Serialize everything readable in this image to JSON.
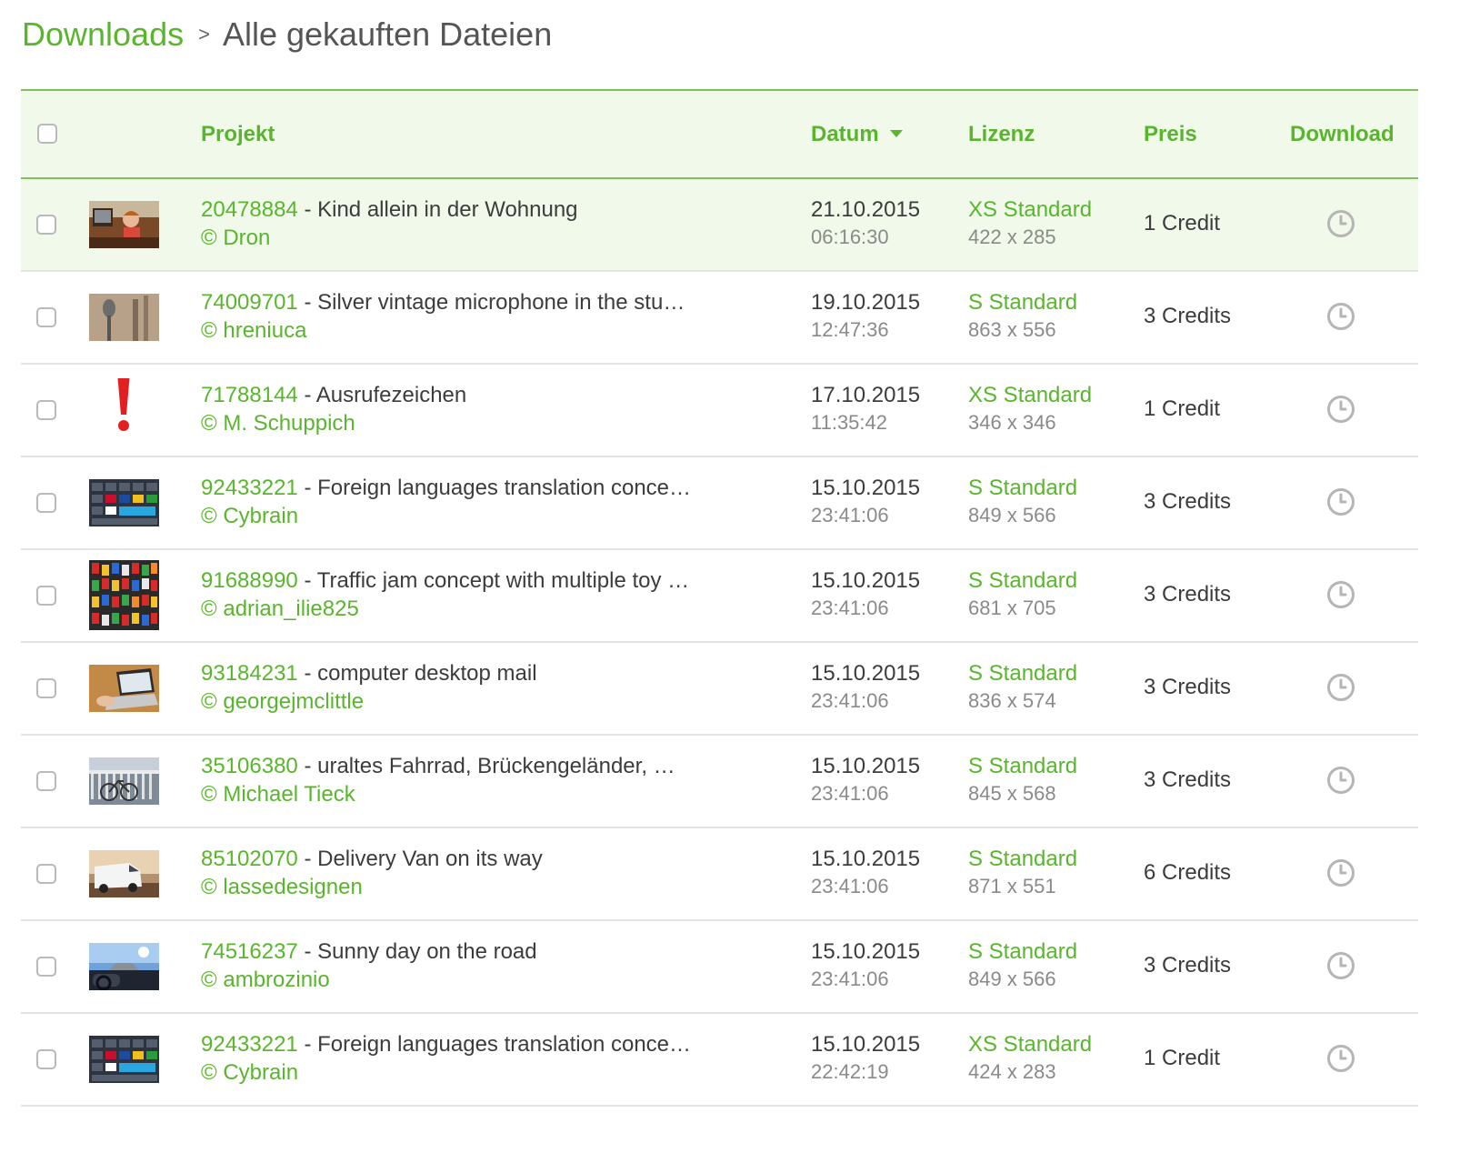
{
  "breadcrumb": {
    "link": "Downloads",
    "separator": ">",
    "current": "Alle gekauften Dateien"
  },
  "table": {
    "headers": {
      "projekt": "Projekt",
      "datum": "Datum",
      "lizenz": "Lizenz",
      "preis": "Preis",
      "download": "Download"
    },
    "rows": [
      {
        "id": "20478884",
        "sep": " - ",
        "title": "Kind allein in der Wohnung",
        "author": "© Dron",
        "date": "21.10.2015",
        "time": "06:16:30",
        "license": "XS Standard",
        "size": "422 x 285",
        "price": "1 Credit",
        "thumb": "child-icon"
      },
      {
        "id": "74009701",
        "sep": " - ",
        "title": "Silver vintage microphone in the stu…",
        "author": "© hreniuca",
        "date": "19.10.2015",
        "time": "12:47:36",
        "license": "S Standard",
        "size": "863 x 556",
        "price": "3 Credits",
        "thumb": "microphone-icon"
      },
      {
        "id": "71788144",
        "sep": " - ",
        "title": "Ausrufezeichen",
        "author": "© M. Schuppich",
        "date": "17.10.2015",
        "time": "11:35:42",
        "license": "XS Standard",
        "size": "346 x 346",
        "price": "1 Credit",
        "thumb": "exclamation-icon"
      },
      {
        "id": "92433221",
        "sep": " - ",
        "title": "Foreign languages translation conce…",
        "author": "© Cybrain",
        "date": "15.10.2015",
        "time": "23:41:06",
        "license": "S Standard",
        "size": "849 x 566",
        "price": "3 Credits",
        "thumb": "keyboard-icon"
      },
      {
        "id": "91688990",
        "sep": " - ",
        "title": "Traffic jam concept with multiple toy …",
        "author": "© adrian_ilie825",
        "date": "15.10.2015",
        "time": "23:41:06",
        "license": "S Standard",
        "size": "681 x 705",
        "price": "3 Credits",
        "thumb": "toy-cars-icon"
      },
      {
        "id": "93184231",
        "sep": " - ",
        "title": "computer desktop mail",
        "author": "© georgejmclittle",
        "date": "15.10.2015",
        "time": "23:41:06",
        "license": "S Standard",
        "size": "836 x 574",
        "price": "3 Credits",
        "thumb": "laptop-icon"
      },
      {
        "id": "35106380",
        "sep": " - ",
        "title": "uraltes Fahrrad, Brückengeländer, …",
        "author": "© Michael Tieck",
        "date": "15.10.2015",
        "time": "23:41:06",
        "license": "S Standard",
        "size": "845 x 568",
        "price": "3 Credits",
        "thumb": "bicycle-icon"
      },
      {
        "id": "85102070",
        "sep": " - ",
        "title": "Delivery Van on its way",
        "author": "© lassedesignen",
        "date": "15.10.2015",
        "time": "23:41:06",
        "license": "S Standard",
        "size": "871 x 551",
        "price": "6 Credits",
        "thumb": "van-icon"
      },
      {
        "id": "74516237",
        "sep": " - ",
        "title": "Sunny day on the road",
        "author": "© ambrozinio",
        "date": "15.10.2015",
        "time": "23:41:06",
        "license": "S Standard",
        "size": "849 x 566",
        "price": "3 Credits",
        "thumb": "road-icon"
      },
      {
        "id": "92433221",
        "sep": " - ",
        "title": "Foreign languages translation conce…",
        "author": "© Cybrain",
        "date": "15.10.2015",
        "time": "22:42:19",
        "license": "XS Standard",
        "size": "424 x 283",
        "price": "1 Credit",
        "thumb": "keyboard-icon"
      }
    ]
  },
  "colors": {
    "accent": "#5ab52e",
    "header_bg": "#f1f9ea",
    "muted_text": "#8a8a8a",
    "icon_gray": "#b5b5b5"
  }
}
